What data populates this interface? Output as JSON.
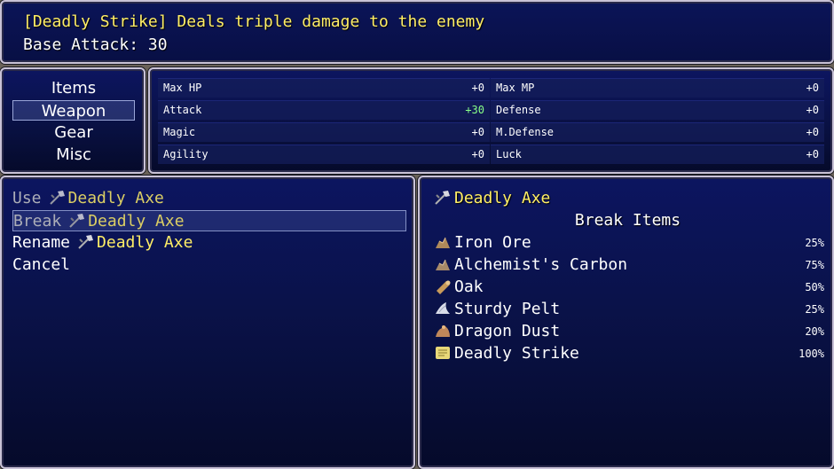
{
  "help": {
    "line1": "[Deadly Strike] Deals triple damage to the enemy",
    "line2": "Base Attack: 30"
  },
  "categories": [
    {
      "label": "Items"
    },
    {
      "label": "Weapon",
      "selected": true
    },
    {
      "label": "Gear"
    },
    {
      "label": "Misc"
    }
  ],
  "stats": {
    "left": [
      {
        "name": "Max HP",
        "value": "+0"
      },
      {
        "name": "Attack",
        "value": "+30"
      },
      {
        "name": "Magic",
        "value": "+0"
      },
      {
        "name": "Agility",
        "value": "+0"
      }
    ],
    "right": [
      {
        "name": "Max MP",
        "value": "+0"
      },
      {
        "name": "Defense",
        "value": "+0"
      },
      {
        "name": "M.Defense",
        "value": "+0"
      },
      {
        "name": "Luck",
        "value": "+0"
      }
    ]
  },
  "commands": [
    {
      "label": "Use",
      "item": "Deadly Axe",
      "enabled": false
    },
    {
      "label": "Break",
      "item": "Deadly Axe",
      "enabled": false,
      "selected": true
    },
    {
      "label": "Rename",
      "item": "Deadly Axe",
      "enabled": true
    },
    {
      "label": "Cancel",
      "item": "",
      "enabled": true
    }
  ],
  "break_panel": {
    "item_name": "Deadly Axe",
    "heading": "Break Items",
    "items": [
      {
        "name": "Iron Ore",
        "chance": "25%",
        "icon": "ore-icon"
      },
      {
        "name": "Alchemist's Carbon",
        "chance": "75%",
        "icon": "ore-icon"
      },
      {
        "name": "Oak",
        "chance": "50%",
        "icon": "wood-log-icon"
      },
      {
        "name": "Sturdy Pelt",
        "chance": "25%",
        "icon": "pelt-icon"
      },
      {
        "name": "Dragon Dust",
        "chance": "20%",
        "icon": "dust-pile-icon"
      },
      {
        "name": "Deadly Strike",
        "chance": "100%",
        "icon": "scroll-icon"
      }
    ]
  },
  "colors": {
    "item_name": "#ffee66",
    "positive_stat": "#88ff88",
    "window_bg": "#0a1249"
  }
}
